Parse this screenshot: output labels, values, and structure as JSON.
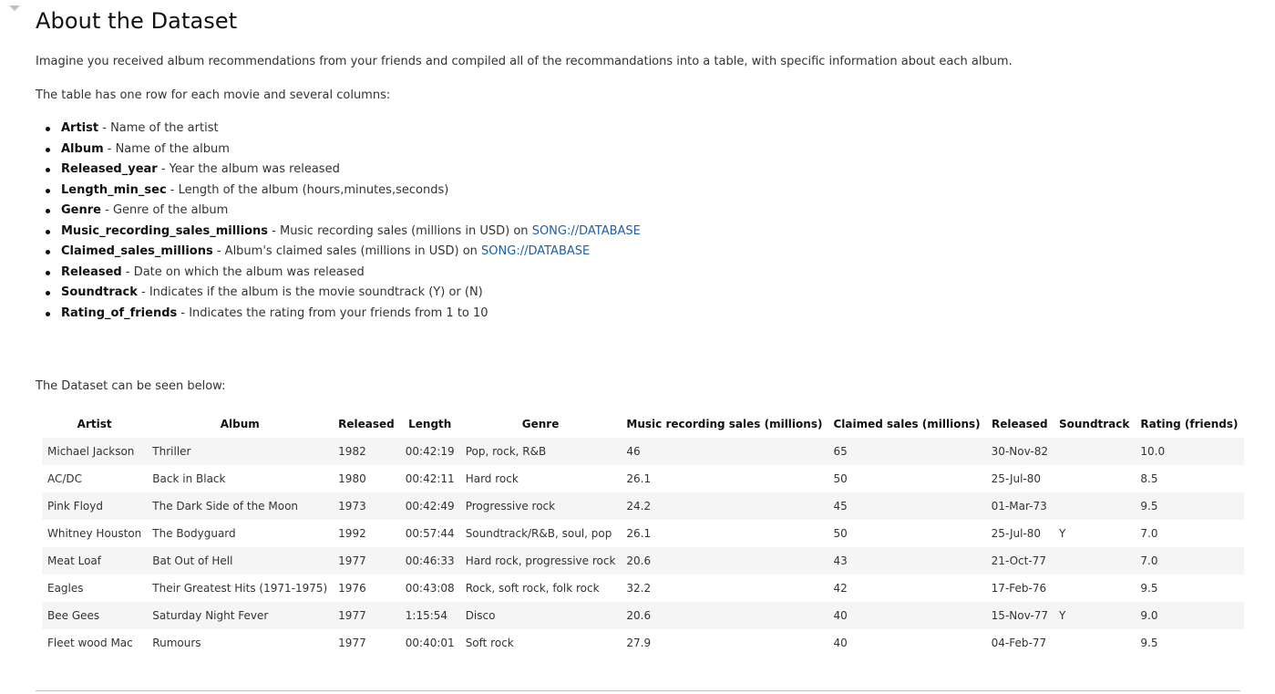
{
  "title": "About the Dataset",
  "intro": "Imagine you received album recommendations from your friends and compiled all of the recommandations into a table, with specific information about each album.",
  "columns_intro": "The table has one row for each movie and several columns:",
  "columns": [
    {
      "name": "Artist",
      "desc": " - Name of the artist",
      "link": null
    },
    {
      "name": "Album",
      "desc": " - Name of the album",
      "link": null
    },
    {
      "name": "Released_year",
      "desc": " - Year the album was released",
      "link": null
    },
    {
      "name": "Length_min_sec",
      "desc": " - Length of the album (hours,minutes,seconds)",
      "link": null
    },
    {
      "name": "Genre",
      "desc": " - Genre of the album",
      "link": null
    },
    {
      "name": "Music_recording_sales_millions",
      "desc": " - Music recording sales (millions in USD) on ",
      "link": "SONG://DATABASE"
    },
    {
      "name": "Claimed_sales_millions",
      "desc": " - Album's claimed sales (millions in USD) on ",
      "link": "SONG://DATABASE"
    },
    {
      "name": "Released",
      "desc": " - Date on which the album was released",
      "link": null
    },
    {
      "name": "Soundtrack",
      "desc": " - Indicates if the album is the movie soundtrack (Y) or (N)",
      "link": null
    },
    {
      "name": "Rating_of_friends",
      "desc": " - Indicates the rating from your friends from 1 to 10",
      "link": null
    }
  ],
  "dataset_intro": "The Dataset can be seen below:",
  "table": {
    "headers": [
      "Artist",
      "Album",
      "Released",
      "Length",
      "Genre",
      "Music recording sales (millions)",
      "Claimed sales (millions)",
      "Released",
      "Soundtrack",
      "Rating (friends)"
    ],
    "rows": [
      [
        "Michael Jackson",
        "Thriller",
        "1982",
        "00:42:19",
        "Pop, rock, R&B",
        "46",
        "65",
        "30-Nov-82",
        "",
        "10.0"
      ],
      [
        "AC/DC",
        "Back in Black",
        "1980",
        "00:42:11",
        "Hard rock",
        "26.1",
        "50",
        "25-Jul-80",
        "",
        "8.5"
      ],
      [
        "Pink Floyd",
        "The Dark Side of the Moon",
        "1973",
        "00:42:49",
        "Progressive rock",
        "24.2",
        "45",
        "01-Mar-73",
        "",
        "9.5"
      ],
      [
        "Whitney Houston",
        "The Bodyguard",
        "1992",
        "00:57:44",
        "Soundtrack/R&B, soul, pop",
        "26.1",
        "50",
        "25-Jul-80",
        "Y",
        "7.0"
      ],
      [
        "Meat Loaf",
        "Bat Out of Hell",
        "1977",
        "00:46:33",
        "Hard rock, progressive rock",
        "20.6",
        "43",
        "21-Oct-77",
        "",
        "7.0"
      ],
      [
        "Eagles",
        "Their Greatest Hits (1971-1975)",
        "1976",
        "00:43:08",
        "Rock, soft rock, folk rock",
        "32.2",
        "42",
        "17-Feb-76",
        "",
        "9.5"
      ],
      [
        "Bee Gees",
        "Saturday Night Fever",
        "1977",
        "1:15:54",
        "Disco",
        "20.6",
        "40",
        "15-Nov-77",
        "Y",
        "9.0"
      ],
      [
        "Fleet wood Mac",
        "Rumours",
        "1977",
        "00:40:01",
        "Soft rock",
        "27.9",
        "40",
        "04-Feb-77",
        "",
        "9.5"
      ]
    ]
  },
  "colors": {
    "link": "#1f5fa6",
    "stripe": "#f5f5f5"
  }
}
